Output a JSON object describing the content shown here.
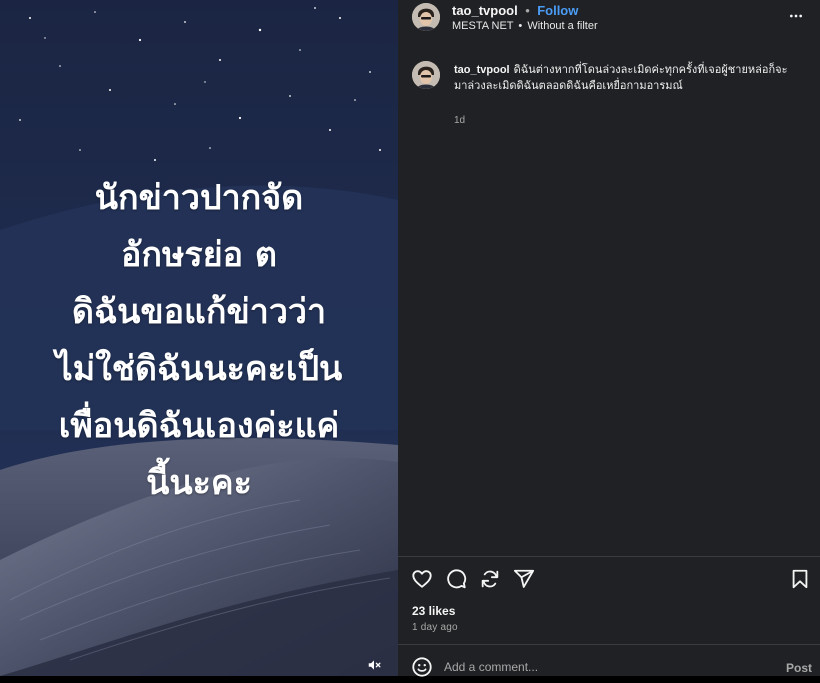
{
  "media": {
    "lines": [
      "นักข่าวปากจัด",
      "อักษรย่อ ต",
      "ดิฉันขอแก้ข่าวว่า",
      "ไม่ใช่ดิฉันนะคะเป็น",
      "เพื่อนดิฉันเองค่ะแค่",
      "นี้นะคะ"
    ],
    "mute_icon": "speaker-muted-icon"
  },
  "header": {
    "username": "tao_tvpool",
    "separator": "•",
    "follow_label": "Follow",
    "audio_artist": "MESTA NET",
    "audio_track": "Without a filter",
    "more_icon": "more-horizontal-icon"
  },
  "caption": {
    "username": "tao_tvpool",
    "text": "ดิฉันต่างหากที่โดนล่วงละเมิดค่ะทุกครั้งที่เจอผู้ชายหล่อก็จะมาล่วงละเมิดดิฉันตลอดดิฉันคือเหยื่อกามอารมณ์",
    "time": "1d"
  },
  "actions": {
    "icons": [
      "heart-icon",
      "comment-icon",
      "repost-icon",
      "share-icon",
      "bookmark-icon"
    ],
    "likes": "23 likes",
    "posted": "1 day ago"
  },
  "composer": {
    "emoji_icon": "emoji-icon",
    "placeholder": "Add a comment...",
    "post_label": "Post"
  },
  "colors": {
    "panel_bg": "#202124",
    "follow_blue": "#4a9cf5",
    "muted_text": "#a8a8a8"
  }
}
